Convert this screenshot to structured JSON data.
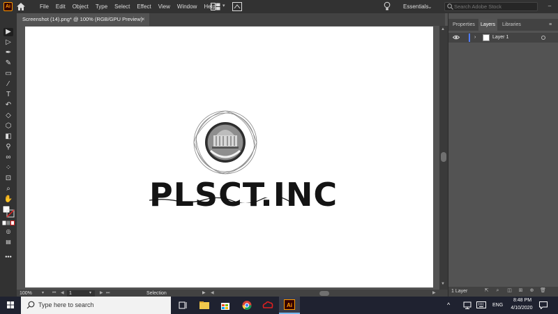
{
  "app": {
    "logo_text": "Ai",
    "menu": [
      "File",
      "Edit",
      "Object",
      "Type",
      "Select",
      "Effect",
      "View",
      "Window",
      "Help"
    ],
    "workspace": "Essentials",
    "search_placeholder": "Search Adobe Stock"
  },
  "document": {
    "tab_title": "Screenshot (14).png* @ 100% (RGB/GPU Preview)",
    "close_label": "×"
  },
  "artwork": {
    "company_name": "PLSCT.INC"
  },
  "tools": [
    {
      "name": "selection-tool",
      "glyph": "▶"
    },
    {
      "name": "direct-selection-tool",
      "glyph": "▷"
    },
    {
      "name": "pen-tool",
      "glyph": "✒"
    },
    {
      "name": "curvature-tool",
      "glyph": "✎"
    },
    {
      "name": "rectangle-tool",
      "glyph": "▭"
    },
    {
      "name": "paintbrush-tool",
      "glyph": "⁄"
    },
    {
      "name": "type-tool",
      "glyph": "T"
    },
    {
      "name": "rotate-tool",
      "glyph": "↶"
    },
    {
      "name": "eraser-tool",
      "glyph": "◇"
    },
    {
      "name": "shape-builder-tool",
      "glyph": "⬡"
    },
    {
      "name": "gradient-tool",
      "glyph": "◧"
    },
    {
      "name": "eyedropper-tool",
      "glyph": "⚲"
    },
    {
      "name": "blend-tool",
      "glyph": "∞"
    },
    {
      "name": "symbol-sprayer-tool",
      "glyph": "⁘"
    },
    {
      "name": "artboard-tool",
      "glyph": "⊡"
    },
    {
      "name": "zoom-tool",
      "glyph": "⌕"
    },
    {
      "name": "hand-tool",
      "glyph": "✋"
    }
  ],
  "statusbar": {
    "zoom": "100%",
    "artboard_number": "1",
    "status": "Selection"
  },
  "panel": {
    "tabs": [
      "Properties",
      "Layers",
      "Libraries"
    ],
    "active_tab": "Layers",
    "menu_icon": "≡",
    "layers": [
      {
        "name": "Layer 1",
        "color": "#4f7cff"
      }
    ],
    "layer_count": "1 Layer"
  },
  "taskbar": {
    "search_text": "Type here to search",
    "lang": "ENG",
    "time": "8:48 PM",
    "date": "4/10/2020",
    "tray_chevron": "^"
  },
  "colors": {
    "menubar": "#323232",
    "canvas": "#535353",
    "artboard": "#ffffff",
    "accent": "#ff9a00",
    "layer_color": "#4f7cff"
  }
}
